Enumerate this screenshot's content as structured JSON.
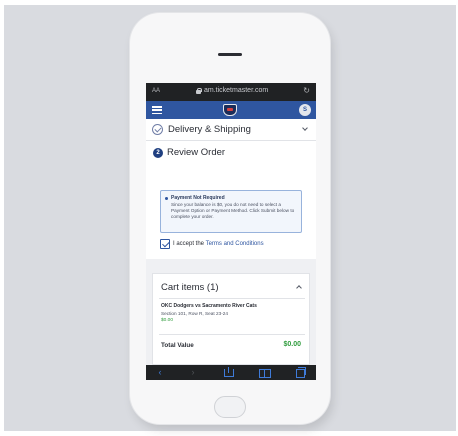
{
  "browser": {
    "text_size_label": "AA",
    "url": "am.ticketmaster.com",
    "reload_glyph": "↻"
  },
  "header": {
    "avatar_initial": "S",
    "brand_color": "#2f56a0"
  },
  "delivery": {
    "label": "Delivery & Shipping"
  },
  "review": {
    "step_number": "2",
    "label": "Review Order"
  },
  "notice": {
    "title": "Payment Not Required",
    "body": "Since your balance is $0, you do not need to select a Payment Option or Payment Method. Click Submit below to complete your order."
  },
  "terms": {
    "prefix": "I accept the ",
    "link": "Terms and Conditions",
    "checked": true
  },
  "cart": {
    "title": "Cart items (1)",
    "items": [
      {
        "event": "OKC Dodgers vs Sacramento River Cats",
        "seat": "Section 101, Row R, Seat 23-24",
        "price": "$0.00"
      }
    ],
    "total_label": "Total Value",
    "total_value": "$0.00",
    "price_color": "#2e9b3c"
  },
  "toolbar": {
    "back_glyph": "‹",
    "forward_glyph": "›"
  }
}
